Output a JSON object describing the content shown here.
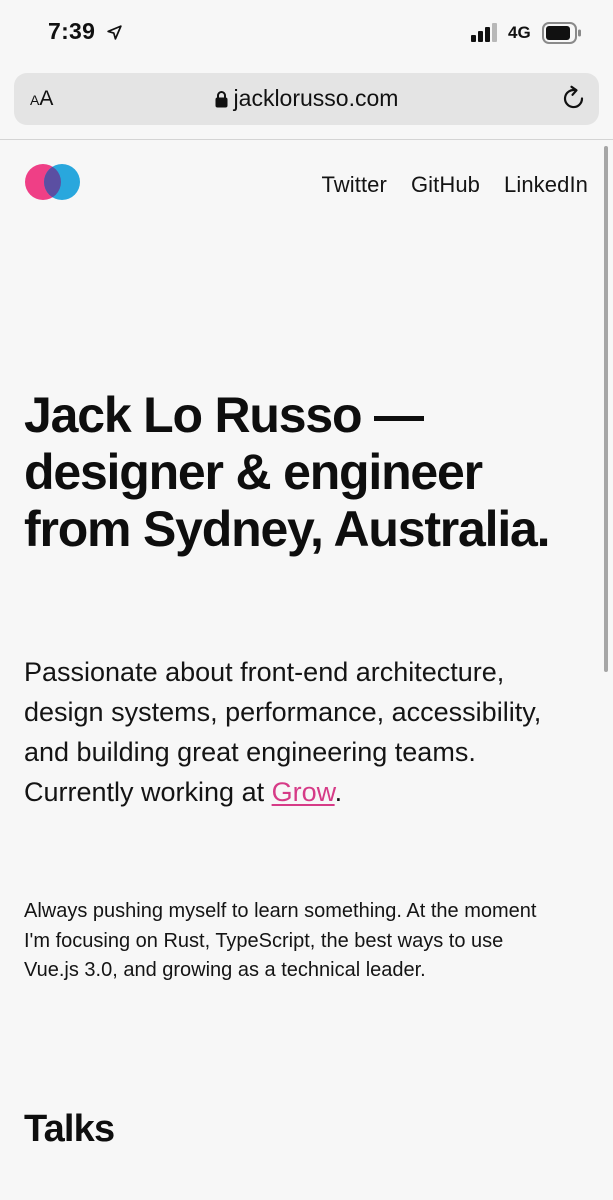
{
  "status_bar": {
    "time": "7:39",
    "network": "4G",
    "icons": [
      "location-arrow-icon",
      "signal-bars-icon",
      "battery-icon"
    ]
  },
  "browser": {
    "text_size_small": "A",
    "text_size_large": "A",
    "url": "jacklorusso.com",
    "icons": [
      "lock-icon",
      "reload-icon"
    ]
  },
  "site": {
    "logo_colors": [
      "#ef3f86",
      "#29a7dd",
      "#5b4fa2"
    ],
    "nav": [
      {
        "label": "Twitter"
      },
      {
        "label": "GitHub"
      },
      {
        "label": "LinkedIn"
      }
    ]
  },
  "hero": {
    "title": "Jack Lo Russo — designer & engineer from Sydney, Australia."
  },
  "intro": {
    "text_before": "Passionate about front-end architecture, design systems, performance, accessibility, and building great engineering teams. Currently working at ",
    "link_label": "Grow",
    "text_after": ".",
    "link_color": "#d63b87"
  },
  "focus": {
    "text": "Always pushing myself to learn something. At the moment I'm focusing on Rust, TypeScript, the best ways to use Vue.js 3.0, and growing as a technical leader."
  },
  "sections": {
    "talks_heading": "Talks"
  }
}
